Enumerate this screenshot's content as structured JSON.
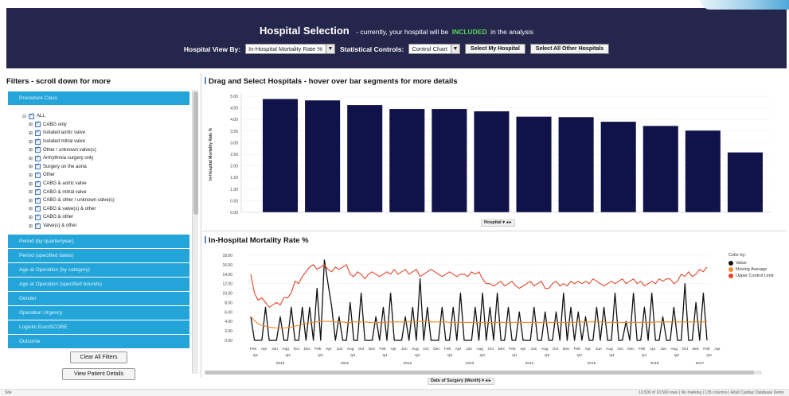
{
  "header": {
    "title": "Hospital Selection",
    "subtitle_prefix": "- currently, your hospital will be",
    "status_word": "INCLUDED",
    "subtitle_suffix": "in the analysis",
    "hospital_view_label": "Hospital View By:",
    "hospital_view_value": "In-Hospital Mortality Rate %",
    "statistical_controls_label": "Statistical Controls:",
    "statistical_controls_value": "Control Chart",
    "select_my_hospital": "Select My Hospital",
    "select_all_other": "Select All Other Hospitals"
  },
  "filters": {
    "title": "Filters - scroll down for more",
    "procedure_class_header": "Procedure Class",
    "tree_root": "ALL",
    "tree_items": [
      "CABG only",
      "Isolated aortic valve",
      "Isolated mitral valve",
      "Other / unknown valve(s)",
      "Arrhythmia surgery only",
      "Surgery on the aorta",
      "Other",
      "CABG & aortic valve",
      "CABG & mitral valve",
      "CABG & other / unknown valve(s)",
      "CABG & valve(s) & other",
      "CABG & other",
      "Valve(s) & other"
    ],
    "other_sections": [
      "Period (by quarter/year)",
      "Period (specified dates)",
      "Age at Operation (by category)",
      "Age at Operation (specified bounds)",
      "Gender",
      "Operation Urgency",
      "Logistic EuroSCORE",
      "Outcome"
    ],
    "clear_button": "Clear All Filters",
    "details_button": "View Patient Details"
  },
  "chart1_title": "Drag and Select Hospitals - hover over bar segments for more details",
  "chart2_title": "In-Hospital Mortality Rate %",
  "hospital_axis_label": "Hospital",
  "date_axis_label": "Date of Surgery (Month)",
  "legend": {
    "title": "Color by:",
    "items": [
      {
        "label": "Value",
        "color": "#111111"
      },
      {
        "label": "Moving Average",
        "color": "#f08a2a"
      },
      {
        "label": "Upper Control Limit",
        "color": "#e2452a"
      }
    ]
  },
  "status": {
    "left": "Site",
    "right": "10,500 of 10,500 rows  |  No marking  |  135 columns  |  Adult Cardiac Database Demo"
  },
  "chart_data": [
    {
      "type": "bar",
      "title": "Drag and Select Hospitals - hover over bar segments for more details",
      "ylabel": "In-Hospital Mortality Rate %",
      "xlabel": "Hospital",
      "ylim": [
        0,
        5.0
      ],
      "yticks": [
        "5.00",
        "4.50",
        "4.00",
        "3.50",
        "3.00",
        "2.50",
        "2.00",
        "1.50",
        "1.00",
        "0.50",
        "0.00"
      ],
      "values": [
        4.88,
        4.82,
        4.62,
        4.45,
        4.45,
        4.35,
        4.12,
        4.1,
        3.9,
        3.72,
        3.52,
        2.58
      ],
      "color": "#10134a"
    },
    {
      "type": "line",
      "title": "In-Hospital Mortality Rate %",
      "xlabel": "Date of Surgery (Month)",
      "ylim": [
        0,
        18
      ],
      "yticks": [
        "18.00",
        "16.00",
        "14.00",
        "12.00",
        "10.00",
        "8.00",
        "6.00",
        "4.00",
        "2.00",
        "0.00"
      ],
      "month_labels": [
        "Feb",
        "Apr",
        "Jun",
        "Aug",
        "Oct",
        "Dec",
        "Feb",
        "Apr",
        "Jun",
        "Aug",
        "Oct",
        "Dec",
        "Feb",
        "Apr",
        "Jun",
        "Aug",
        "Oct",
        "Dec",
        "Feb",
        "Apr",
        "Jun",
        "Aug",
        "Oct",
        "Dec",
        "Feb",
        "Apr",
        "Jun",
        "Aug",
        "Oct",
        "Dec",
        "Feb",
        "Apr",
        "Jun",
        "Aug",
        "Oct",
        "Dec",
        "Feb",
        "Apr",
        "Jun",
        "Aug",
        "Oct",
        "Dec",
        "Feb",
        "Apr"
      ],
      "quarter_labels": [
        "Q1",
        "Q2",
        "Q3",
        "Q4"
      ],
      "year_labels": [
        "2010",
        "2011",
        "2012",
        "2013",
        "2014",
        "2015",
        "2016",
        "2017"
      ],
      "series": [
        {
          "name": "Value",
          "color": "#111111",
          "values": [
            5,
            0,
            0,
            0,
            7,
            0,
            0,
            0,
            5,
            0,
            0,
            7,
            0,
            0,
            7,
            0,
            7,
            0,
            11,
            0,
            17,
            12,
            7,
            0,
            5,
            0,
            0,
            8,
            0,
            0,
            10,
            0,
            0,
            0,
            5,
            0,
            7,
            0,
            10,
            0,
            0,
            0,
            5,
            0,
            7,
            0,
            13,
            0,
            7,
            0,
            0,
            0,
            7,
            0,
            0,
            7,
            0,
            10,
            0,
            0,
            0,
            7,
            0,
            10,
            0,
            7,
            0,
            10,
            0,
            0,
            7,
            0,
            0,
            6,
            0,
            0,
            0,
            7,
            0,
            0,
            6,
            0,
            0,
            6,
            0,
            10,
            0,
            7,
            0,
            6,
            0,
            5,
            0,
            0,
            7,
            0,
            7,
            0,
            0,
            10,
            0,
            0,
            4,
            0,
            10,
            0,
            0,
            7,
            0,
            10,
            0,
            0,
            5,
            0,
            0,
            7,
            0,
            0,
            12,
            0,
            0,
            8,
            0,
            10,
            0
          ]
        },
        {
          "name": "Moving Average",
          "color": "#f08a2a",
          "values": [
            5,
            4.2,
            3.5,
            3.2,
            3,
            2.8,
            2.7,
            2.6,
            2.6,
            2.6,
            2.7,
            2.8,
            3,
            3.2,
            3.4,
            3.6,
            3.7,
            3.8,
            3.9,
            4,
            4,
            4,
            4,
            3.9,
            3.9,
            3.9,
            3.8,
            3.8,
            3.9,
            3.9,
            3.9,
            3.9,
            3.8,
            3.8,
            3.8,
            3.8,
            3.8,
            3.8,
            3.9,
            3.9,
            3.9,
            3.9,
            3.9,
            3.9,
            3.9,
            3.9,
            4,
            4,
            4,
            3.9,
            3.9,
            3.9,
            3.9,
            3.9,
            3.8,
            3.8,
            3.8,
            3.8,
            3.8,
            3.8,
            3.8,
            3.8,
            3.8,
            3.8,
            3.8,
            3.8,
            3.8,
            3.8,
            3.8,
            3.8,
            3.8,
            3.8,
            3.8,
            3.8,
            3.8,
            3.8,
            3.8,
            3.8,
            3.8,
            3.8,
            3.8,
            3.8,
            3.8,
            3.8,
            3.8,
            3.8,
            3.8,
            3.8,
            3.8,
            3.9,
            3.9,
            3.9,
            3.9,
            3.9,
            3.9,
            3.9,
            3.9,
            3.8,
            3.8,
            3.8,
            3.8,
            3.8,
            3.8,
            3.8,
            3.8,
            3.8,
            3.8,
            3.8,
            3.8,
            3.8,
            3.9,
            3.9,
            3.9,
            3.9,
            3.9,
            3.9,
            3.9,
            3.9,
            3.9,
            3.9,
            3.9,
            3.9,
            3.9,
            3.9,
            3.9
          ]
        },
        {
          "name": "Upper Control Limit",
          "color": "#e2452a",
          "values": [
            14,
            10,
            8.5,
            9,
            8,
            7,
            7.5,
            8,
            7.5,
            9,
            9,
            10,
            12.5,
            12,
            13.5,
            14.5,
            15.5,
            16,
            15,
            15.5,
            16,
            15,
            14.5,
            15.5,
            15,
            15.5,
            16,
            14,
            13.5,
            14.5,
            14,
            13,
            14,
            14.5,
            14,
            13.5,
            14,
            14.5,
            14,
            15,
            14,
            14.5,
            15,
            14,
            14.5,
            15,
            13.5,
            14,
            14.5,
            15,
            14.5,
            14,
            13.5,
            14,
            14.5,
            14,
            13.5,
            14,
            14,
            13.5,
            14.5,
            14,
            14.5,
            13,
            12,
            12,
            11.5,
            12,
            12.5,
            11.5,
            12,
            12.5,
            11.5,
            11,
            11.5,
            12,
            12.5,
            11.5,
            12,
            12.5,
            11,
            11,
            12,
            12.5,
            11.5,
            12,
            11.5,
            12.5,
            12,
            12.5,
            12,
            12.5,
            12,
            13,
            12.5,
            12,
            11.5,
            12,
            12.5,
            12,
            12.5,
            13,
            12,
            12.5,
            13,
            12,
            12.5,
            11.5,
            12,
            12.5,
            12,
            13,
            12.5,
            13,
            13,
            12,
            12.5,
            14,
            13.5,
            14.5,
            13.5,
            14,
            15,
            14.5,
            15.5
          ]
        }
      ]
    }
  ]
}
